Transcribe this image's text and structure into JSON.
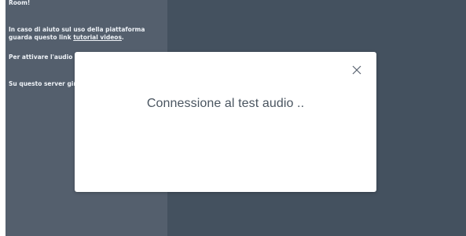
{
  "chat": {
    "welcome_fragment": "Room!",
    "help_text": "In caso di aiuto sul uso della piattaforma guarda questo link ",
    "help_link": "tutorial videos",
    "help_suffix": ".",
    "audio_text": "Per attivare l'audio p",
    "server_text": "Su questo server gira"
  },
  "modal": {
    "title": "Connessione al test audio ..",
    "close_icon": "close-icon"
  },
  "colors": {
    "main_background": "#06172a",
    "chat_background": "#1b2a3c",
    "modal_background": "#ffffff",
    "modal_text": "#4a5560"
  }
}
